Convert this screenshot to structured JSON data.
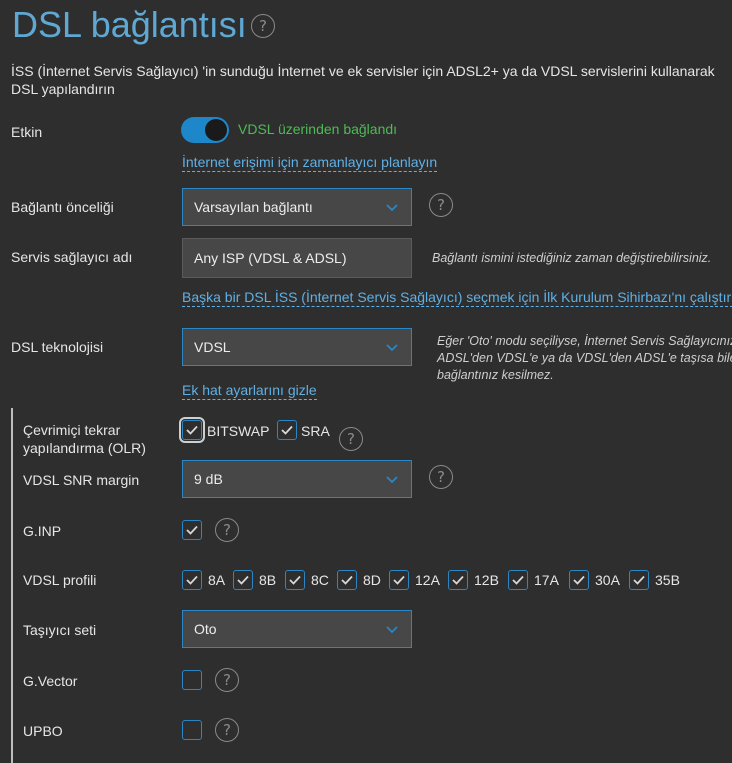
{
  "page": {
    "title": "DSL bağlantısı",
    "description": "İSS (İnternet Servis Sağlayıcı) 'in sunduğu İnternet ve ek servisler için ADSL2+ ya da VDSL servislerini kullanarak DSL yapılandırın"
  },
  "enabled": {
    "label": "Etkin",
    "status": "VDSL üzerinden bağlandı",
    "toggle_on": true
  },
  "scheduler_link": "İnternet erişimi için zamanlayıcı planlayın",
  "priority": {
    "label": "Bağlantı önceliği",
    "value": "Varsayılan bağlantı"
  },
  "provider": {
    "label": "Servis sağlayıcı adı",
    "value": "Any ISP (VDSL & ADSL)",
    "hint": "Bağlantı ismini istediğiniz zaman değiştirebilirsiniz."
  },
  "wizard_link": "Başka bir DSL İSS (İnternet Servis Sağlayıcı) seçmek için İlk Kurulum Sihirbazı'nı çalıştırın",
  "technology": {
    "label": "DSL teknolojisi",
    "value": "VDSL",
    "hint_lines": [
      "Eğer 'Oto' modu seçiliyse, İnternet Servis Sağlayıcınız",
      "ADSL'den VDSL'e ya da VDSL'den ADSL'e taşısa bile İnte",
      "bağlantınız kesilmez."
    ]
  },
  "advanced_link": "Ek hat ayarlarını gizle",
  "olr": {
    "label_line1": "Çevrimiçi tekrar",
    "label_line2": "yapılandırma (OLR)",
    "bitswap_label": "BITSWAP",
    "sra_label": "SRA",
    "bitswap": true,
    "sra": true
  },
  "snr": {
    "label": "VDSL SNR margin",
    "value": "9 dB"
  },
  "ginp": {
    "label": "G.INP",
    "checked": true
  },
  "profiles": {
    "label": "VDSL profili",
    "items": [
      "8A",
      "8B",
      "8C",
      "8D",
      "12A",
      "12B",
      "17A",
      "30A",
      "35B"
    ]
  },
  "carrier": {
    "label": "Taşıyıcı seti",
    "value": "Oto"
  },
  "gvector": {
    "label": "G.Vector",
    "checked": false
  },
  "upbo": {
    "label": "UPBO",
    "checked": false
  },
  "help_glyph": "?",
  "colors": {
    "accent": "#1d87c9",
    "title": "#5fa8d3",
    "status_green": "#4fba56",
    "link": "#5fb0e6",
    "background": "#2e2e2e"
  }
}
